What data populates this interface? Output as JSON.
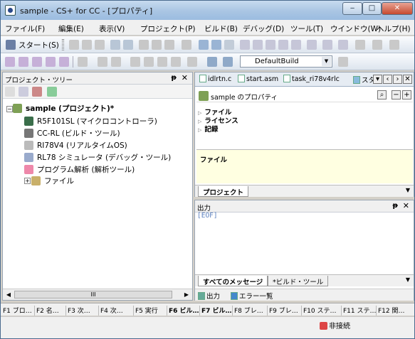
{
  "window": {
    "title": "sample - CS+ for CC - [プロパティ]",
    "minimize": "‒",
    "maximize": "□",
    "close": "✕"
  },
  "menu": [
    "ファイル(F)",
    "編集(E)",
    "表示(V)",
    "プロジェクト(P)",
    "ビルド(B)",
    "デバッグ(D)",
    "ツール(T)",
    "ウインドウ(W)",
    "ヘルプ(H)"
  ],
  "toolbar": {
    "start_label": "スタート(S)",
    "build_config": "DefaultBuild"
  },
  "project_tree": {
    "title": "プロジェクト・ツリー",
    "nodes": [
      {
        "label": "sample (プロジェクト)*",
        "icon": "project-icon"
      },
      {
        "label": "R5F101SL (マイクロコントローラ)",
        "icon": "chip-icon"
      },
      {
        "label": "CC-RL (ビルド・ツール)",
        "icon": "hammer-icon"
      },
      {
        "label": "RI78V4 (リアルタイムOS)",
        "icon": "rtos-icon"
      },
      {
        "label": "RL78 シミュレータ (デバッグ・ツール)",
        "icon": "debugger-icon"
      },
      {
        "label": "プログラム解析 (解析ツール)",
        "icon": "analysis-icon"
      },
      {
        "label": "ファイル",
        "icon": "folder-icon"
      }
    ],
    "scroll_thumb": "III"
  },
  "doc_tabs": [
    "idlrtn.c",
    "start.asm",
    "task_ri78v4rlc",
    "スタ"
  ],
  "properties": {
    "title": "sample のプロパティ",
    "categories": [
      "ファイル",
      "ライセンス",
      "記録"
    ],
    "description": "ファイル",
    "tab": "プロジェクト"
  },
  "output": {
    "title": "出力",
    "text": "[EOF]",
    "tabs": [
      "すべてのメッセージ",
      "*ビルド・ツール"
    ],
    "panel_tabs": [
      "出力",
      "エラー一覧"
    ]
  },
  "function_keys": [
    "F1 ブロ…",
    "F2 名…",
    "F3 次…",
    "F4 次…",
    "F5 実行",
    "F6 ビル…",
    "F7 ビル…",
    "F8 ブレ…",
    "F9 ブレ…",
    "F10 ステ…",
    "F11 ステ…",
    "F12 関…"
  ],
  "status": {
    "connection": "非接続"
  }
}
